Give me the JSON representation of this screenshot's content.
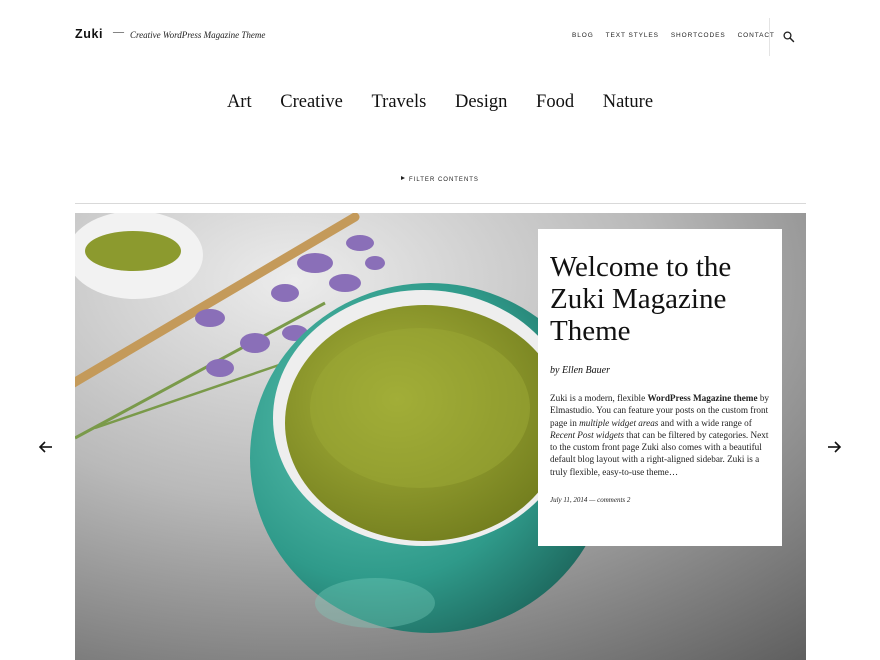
{
  "header": {
    "logo": "Zuki",
    "dash": "—",
    "tagline": "Creative WordPress Magazine Theme",
    "nav": [
      "BLOG",
      "TEXT STYLES",
      "SHORTCODES",
      "CONTACT"
    ]
  },
  "categories": [
    "Art",
    "Creative",
    "Travels",
    "Design",
    "Food",
    "Nature"
  ],
  "filter_label": "FILTER CONTENTS",
  "featured": {
    "title": "Welcome to the Zuki Magazine Theme",
    "byline": "by Ellen Bauer",
    "excerpt": {
      "t1": "Zuki is a modern, flexible ",
      "b1": "WordPress Magazine theme",
      "t2": " by Elmastudio. You can feature your posts on the custom front page in ",
      "i1": "multiple widget areas",
      "t3": " and with a wide range of ",
      "i2": "Recent Post widgets",
      "t4": " that can be filtered by categories. Next to the custom front page Zuki also comes with a beautiful default blog layout with a right-aligned sidebar. Zuki is a truly flexible, easy-to-use theme…"
    },
    "date": "July 11, 2014",
    "meta_sep": "—",
    "comments": "comments 2"
  },
  "icons": {
    "search": "search-icon",
    "prev": "arrow-left-icon",
    "next": "arrow-right-icon"
  },
  "colors": {
    "bowl": "#2f9a8a",
    "matcha": "#8c9a2e",
    "lavender": "#8a6fb8"
  }
}
